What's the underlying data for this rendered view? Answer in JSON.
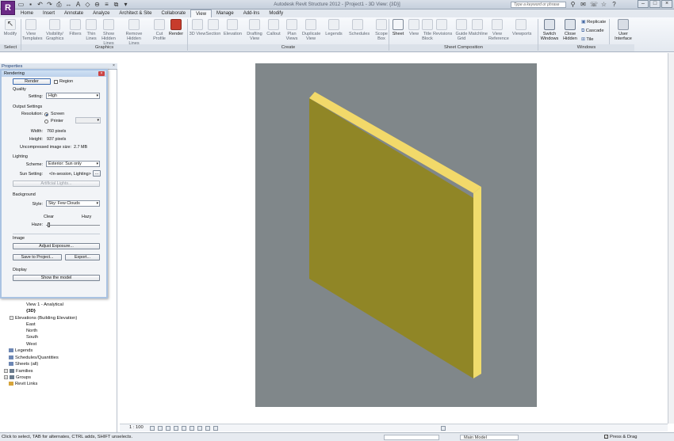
{
  "window": {
    "title": "Autodesk Revit Structure 2012 - [Project1 - 3D View: {3D}]",
    "search_placeholder": "Type a keyword or phrase",
    "app_button": "R"
  },
  "tabs": [
    "Home",
    "Insert",
    "Annotate",
    "Analyze",
    "Architect & Site",
    "Collaborate",
    "View",
    "Manage",
    "Add-Ins",
    "Modify"
  ],
  "active_tab": "View",
  "ribbon": {
    "modify": "Modify",
    "graphics": [
      "View Templates",
      "Visibility/ Graphics",
      "Filters",
      "Thin Lines",
      "Show Hidden Lines",
      "Remove Hidden Lines",
      "Cut Profile",
      "Render"
    ],
    "create": [
      "3D View",
      "Section",
      "Elevation",
      "Drafting View",
      "Callout",
      "Plan Views",
      "Duplicate View",
      "Legends",
      "Schedules",
      "Scope Box"
    ],
    "sheet_composition": [
      "Sheet",
      "View",
      "Title Block",
      "Revisions",
      "Guide Grid",
      "Matchline",
      "View Reference",
      "Viewports"
    ],
    "windows": [
      "Switch Windows",
      "Close Hidden"
    ],
    "windows_small": [
      "Replicate",
      "Cascade",
      "Tile"
    ],
    "user_interface": "User Interface",
    "panels": {
      "select": "Select",
      "graphics": "Graphics",
      "create": "Create",
      "sheet_composition": "Sheet Composition",
      "windows": "Windows"
    }
  },
  "properties_title": "Properties",
  "dialog": {
    "title": "Rendering",
    "render_button": "Render",
    "region_label": "Region",
    "quality_header": "Quality",
    "setting_label": "Setting:",
    "setting_value": "High",
    "output_header": "Output Settings",
    "resolution_label": "Resolution:",
    "screen_label": "Screen",
    "printer_label": "Printer",
    "width_label": "Width:",
    "width_value": "760 pixels",
    "height_label": "Height:",
    "height_value": "937 pixels",
    "size_label": "Uncompressed image size:",
    "size_value": "2.7 MB",
    "lighting_header": "Lighting",
    "scheme_label": "Scheme:",
    "scheme_value": "Exterior: Sun only",
    "sun_label": "Sun Setting:",
    "sun_value": "<In-session, Lighting>",
    "sun_browse": "...",
    "artificial_button": "Artificial Lights...",
    "background_header": "Background",
    "style_label": "Style:",
    "style_value": "Sky: Few Clouds",
    "clear_label": "Clear",
    "hazy_label": "Hazy",
    "haze_label": "Haze:",
    "haze_level": 0.05,
    "image_header": "Image",
    "adjust_button": "Adjust Exposure...",
    "save_button": "Save to Project...",
    "export_button": "Export...",
    "display_header": "Display",
    "show_model_button": "Show the model"
  },
  "tree": [
    {
      "label": "View 1 - Analytical",
      "bold": false
    },
    {
      "label": "{3D}",
      "bold": true
    },
    {
      "label": "Elevations (Building Elevation)",
      "bold": false
    },
    {
      "label": "East",
      "bold": false
    },
    {
      "label": "North",
      "bold": false
    },
    {
      "label": "South",
      "bold": false
    },
    {
      "label": "West",
      "bold": false
    },
    {
      "label": "Legends",
      "bold": false
    },
    {
      "label": "Schedules/Quantities",
      "bold": false
    },
    {
      "label": "Sheets (all)",
      "bold": false
    },
    {
      "label": "Families",
      "bold": false
    },
    {
      "label": "Groups",
      "bold": false
    },
    {
      "label": "Revit Links",
      "bold": false
    }
  ],
  "view_bar": {
    "scale": "1 : 100"
  },
  "status": {
    "hint": "Click to select, TAB for alternates, CTRL adds, SHIFT unselects.",
    "model_combo": "Main Model",
    "press_drag": "Press & Drag"
  },
  "colors": {
    "wall_front": "#908626",
    "wall_top": "#f2d96a",
    "wall_side": "#f0dc6c",
    "view_background": "#80878a"
  }
}
